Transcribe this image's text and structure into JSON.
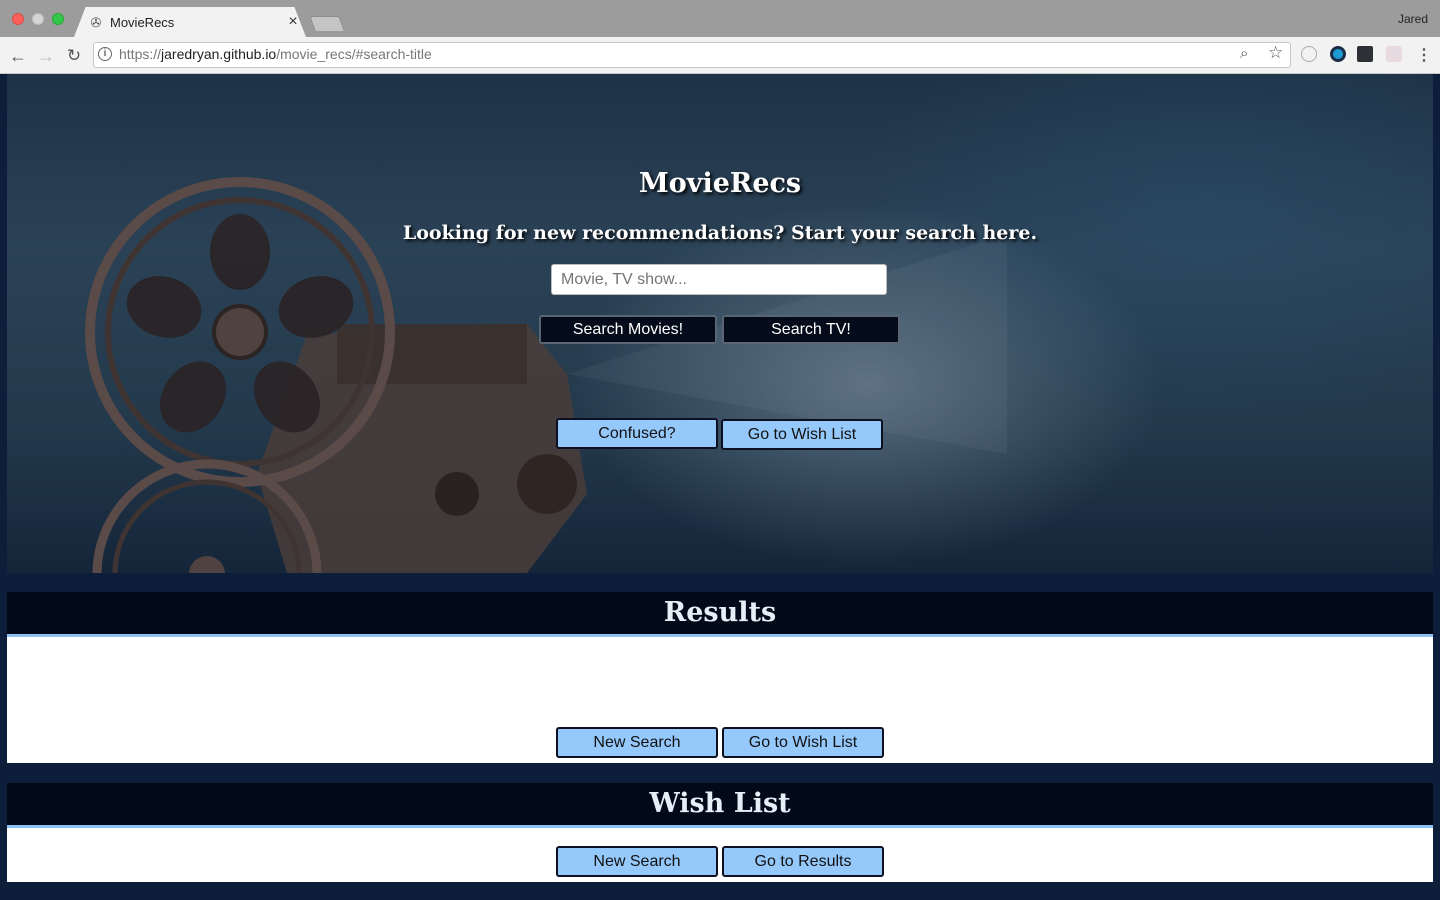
{
  "browser": {
    "tab_title": "MovieRecs",
    "tab_close": "×",
    "profile_name": "Jared",
    "url_scheme": "https://",
    "url_host": "jaredryan.github.io",
    "url_path": "/movie_recs/#search-title",
    "icons": [
      "back-icon",
      "forward-icon",
      "reload-icon",
      "info-icon",
      "zoom-icon",
      "star-icon",
      "menu-icon"
    ]
  },
  "hero": {
    "title": "MovieRecs",
    "subtitle": "Looking for new recommendations? Start your search here.",
    "search_placeholder": "Movie, TV show...",
    "search_movies_label": "Search Movies!",
    "search_tv_label": "Search TV!",
    "confused_label": "Confused?",
    "wish_list_label": "Go to Wish List"
  },
  "results": {
    "heading": "Results",
    "new_search_label": "New Search",
    "wish_list_label": "Go to Wish List"
  },
  "wish_list": {
    "heading": "Wish List",
    "new_search_label": "New Search",
    "results_label": "Go to Results"
  },
  "colors": {
    "page_background": "#0c1e3a",
    "section_header": "#020a1a",
    "accent_blue": "#96c9fb",
    "dark_button": "#040b1a"
  }
}
